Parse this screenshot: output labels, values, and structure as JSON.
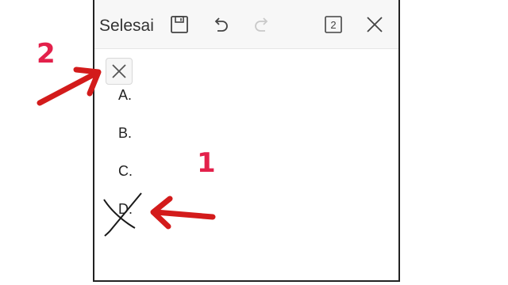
{
  "toolbar": {
    "done_label": "Selesai",
    "page_count": "2",
    "icons": [
      "save-icon",
      "undo-icon",
      "redo-icon",
      "page-count-icon",
      "close-icon"
    ]
  },
  "options": [
    {
      "label": "A."
    },
    {
      "label": "B."
    },
    {
      "label": "C."
    },
    {
      "label": "D."
    }
  ],
  "annotations": {
    "step1": "1",
    "step2": "2",
    "accent": "#e3214b"
  }
}
